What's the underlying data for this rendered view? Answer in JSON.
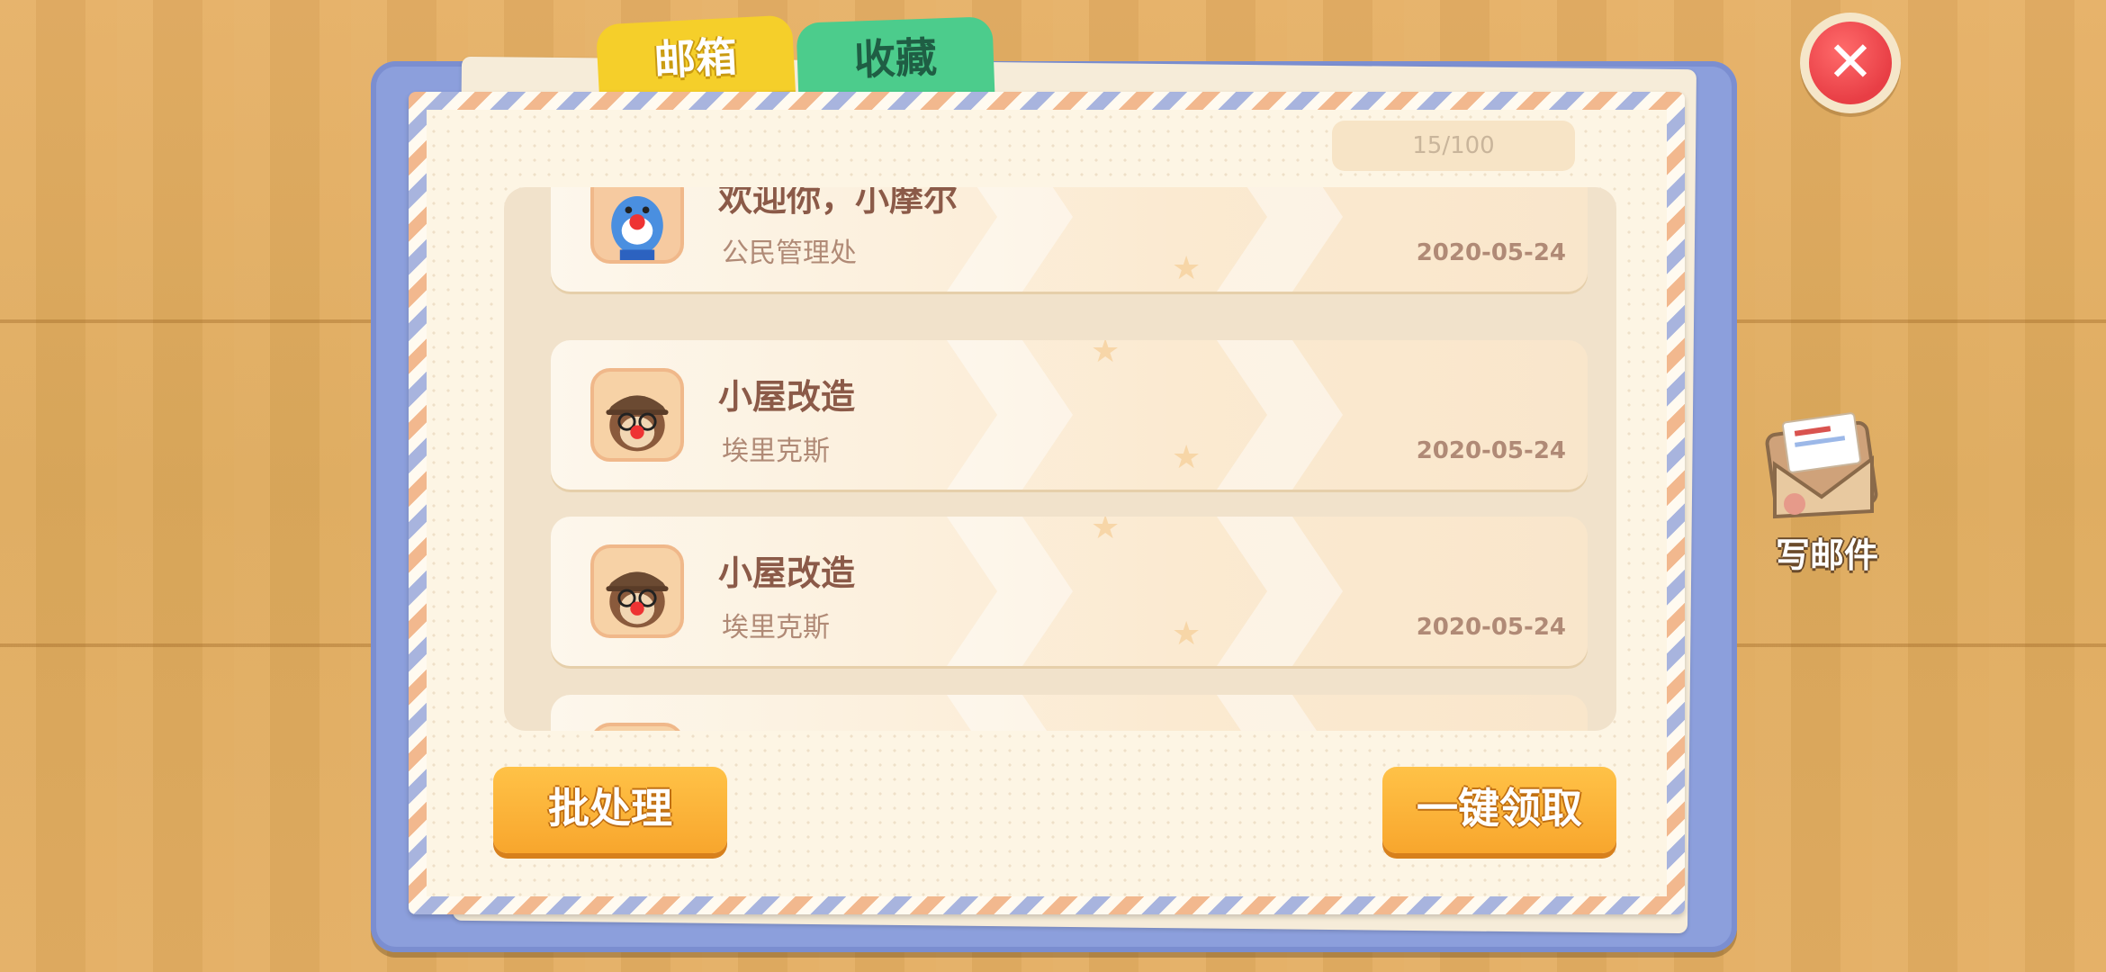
{
  "tabs": [
    {
      "label": "邮箱",
      "active": true
    },
    {
      "label": "收藏",
      "active": false
    }
  ],
  "counter": "15/100",
  "mails": [
    {
      "title": "欢迎你，小摩尔",
      "sender": "公民管理处",
      "date": "2020-05-24",
      "avatar": "blue-mole-avatar"
    },
    {
      "title": "小屋改造",
      "sender": "埃里克斯",
      "date": "2020-05-24",
      "avatar": "detective-mole-avatar"
    },
    {
      "title": "小屋改造",
      "sender": "埃里克斯",
      "date": "2020-05-24",
      "avatar": "detective-mole-avatar"
    }
  ],
  "buttons": {
    "batch": "批处理",
    "claim_all": "一键领取"
  },
  "write_mail": {
    "label": "写邮件",
    "icon": "envelope-icon"
  },
  "close_icon": "close-icon",
  "colors": {
    "board": "#8c9fdc",
    "tab_mailbox": "#f5cf2a",
    "tab_favorites": "#4ccc8c",
    "button": "#f8a62d",
    "close": "#e83e45"
  }
}
